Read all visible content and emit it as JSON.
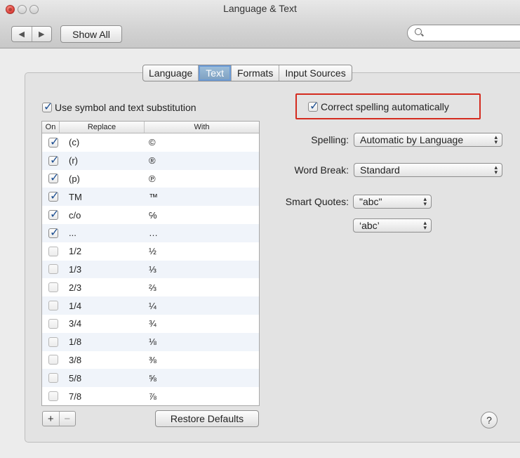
{
  "window": {
    "title": "Language & Text"
  },
  "toolbar": {
    "back": "◀",
    "forward": "▶",
    "show_all": "Show All",
    "search_placeholder": ""
  },
  "tabs": [
    {
      "label": "Language",
      "selected": false
    },
    {
      "label": "Text",
      "selected": true
    },
    {
      "label": "Formats",
      "selected": false
    },
    {
      "label": "Input Sources",
      "selected": false
    }
  ],
  "substitution": {
    "label": "Use symbol and text substitution",
    "checked": true,
    "columns": {
      "on": "On",
      "replace": "Replace",
      "with": "With"
    },
    "rows": [
      {
        "on": true,
        "replace": "(c)",
        "with": "©"
      },
      {
        "on": true,
        "replace": "(r)",
        "with": "®"
      },
      {
        "on": true,
        "replace": "(p)",
        "with": "℗"
      },
      {
        "on": true,
        "replace": "TM",
        "with": "™"
      },
      {
        "on": true,
        "replace": "c/o",
        "with": "℅"
      },
      {
        "on": true,
        "replace": "...",
        "with": "…"
      },
      {
        "on": false,
        "replace": "1/2",
        "with": "½"
      },
      {
        "on": false,
        "replace": "1/3",
        "with": "⅓"
      },
      {
        "on": false,
        "replace": "2/3",
        "with": "⅔"
      },
      {
        "on": false,
        "replace": "1/4",
        "with": "¼"
      },
      {
        "on": false,
        "replace": "3/4",
        "with": "¾"
      },
      {
        "on": false,
        "replace": "1/8",
        "with": "⅛"
      },
      {
        "on": false,
        "replace": "3/8",
        "with": "⅜"
      },
      {
        "on": false,
        "replace": "5/8",
        "with": "⅝"
      },
      {
        "on": false,
        "replace": "7/8",
        "with": "⅞"
      }
    ],
    "add": "+",
    "remove": "−",
    "restore_defaults": "Restore Defaults"
  },
  "spelling_options": {
    "correct_label": "Correct spelling automatically",
    "correct_checked": true,
    "highlight_color": "#d42b1f",
    "spelling_label": "Spelling:",
    "spelling_value": "Automatic by Language",
    "word_break_label": "Word Break:",
    "word_break_value": "Standard",
    "smart_quotes_label": "Smart Quotes:",
    "double_quotes_value": "\"abc\"",
    "single_quotes_value": "‘abc’"
  },
  "help": "?"
}
